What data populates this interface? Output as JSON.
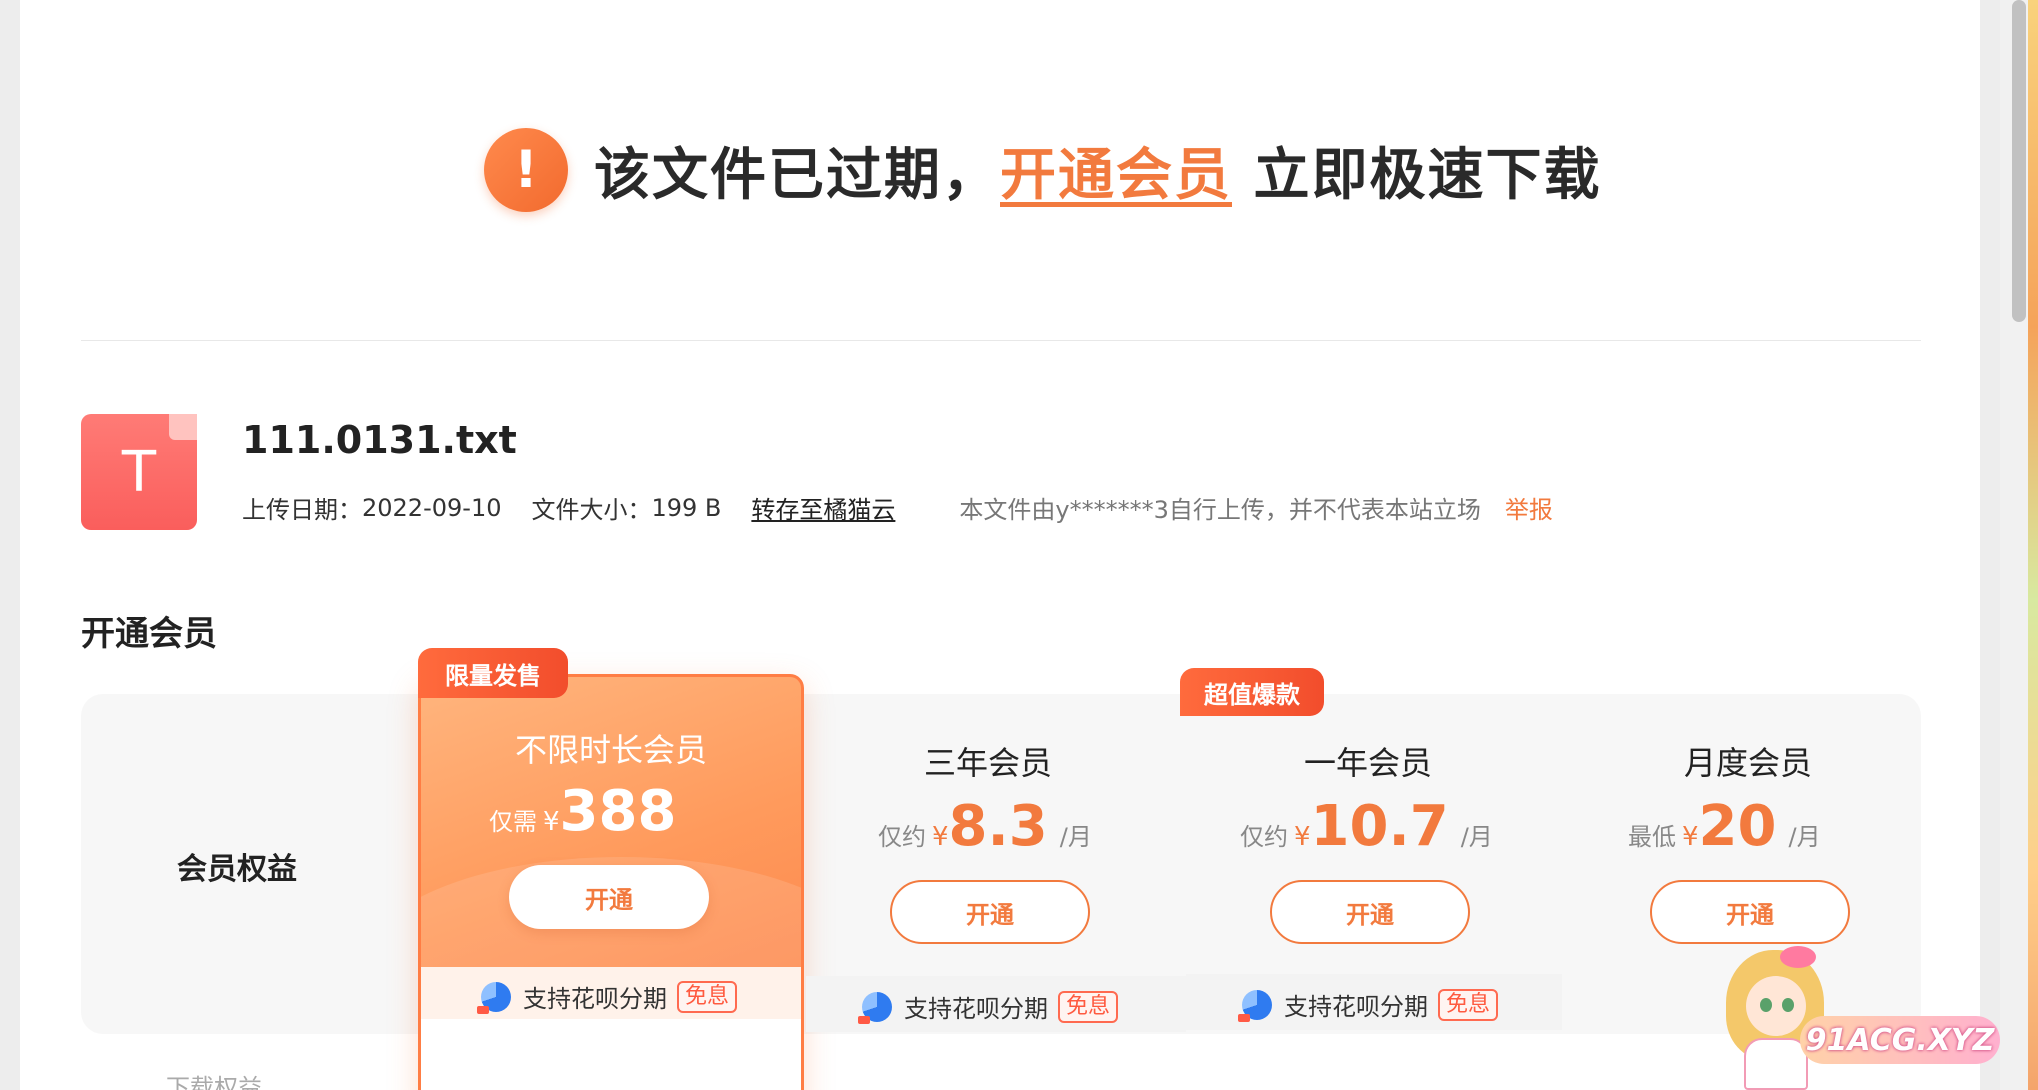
{
  "alert": {
    "icon": "!",
    "text_before": "该文件已过期，",
    "link_text": "开通会员",
    "text_after": " 立即极速下载",
    "accent_color": "#f27a3e"
  },
  "file": {
    "type_letter": "T",
    "name": "111.0131.txt",
    "upload_date_label": "上传日期：",
    "upload_date": "2022-09-10",
    "size_label": "文件大小：",
    "size": "199 B",
    "save_link": "转存至橘猫云",
    "disclaimer": "本文件由y*******3自行上传，并不代表本站立场",
    "report_link": "举报"
  },
  "membership": {
    "section_title": "开通会员",
    "benefit_label": "会员权益",
    "benefit_sub": "下载权益",
    "plans": [
      {
        "badge": "限量发售",
        "name": "不限时长会员",
        "price_prefix": "仅需",
        "currency": "¥",
        "price": "388",
        "unit": "",
        "button": "开通",
        "installment": "支持花呗分期",
        "free_tag": "免息"
      },
      {
        "badge": "",
        "name": "三年会员",
        "price_prefix": "仅约",
        "currency": "¥",
        "price": "8.3",
        "unit": "/月",
        "button": "开通",
        "installment": "支持花呗分期",
        "free_tag": "免息"
      },
      {
        "badge": "超值爆款",
        "name": "一年会员",
        "price_prefix": "仅约",
        "currency": "¥",
        "price": "10.7",
        "unit": "/月",
        "button": "开通",
        "installment": "支持花呗分期",
        "free_tag": "免息"
      },
      {
        "badge": "",
        "name": "月度会员",
        "price_prefix": "最低",
        "currency": "¥",
        "price": "20",
        "unit": "/月",
        "button": "开通",
        "installment": "",
        "free_tag": ""
      }
    ]
  },
  "watermark": {
    "site": "91ACG.XYZ"
  }
}
